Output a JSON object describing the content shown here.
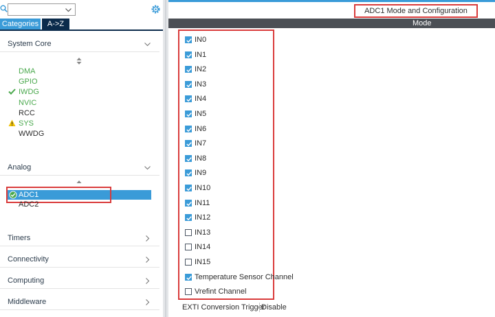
{
  "left": {
    "tabs": [
      {
        "label": "Categories"
      },
      {
        "label": "A->Z"
      }
    ],
    "system_core": {
      "label": "System Core",
      "items": [
        {
          "label": "DMA",
          "status": "none"
        },
        {
          "label": "GPIO",
          "status": "none"
        },
        {
          "label": "IWDG",
          "status": "ok"
        },
        {
          "label": "NVIC",
          "status": "none"
        },
        {
          "label": "RCC",
          "status": "none"
        },
        {
          "label": "SYS",
          "status": "warning"
        },
        {
          "label": "WWDG",
          "status": "none"
        }
      ]
    },
    "analog": {
      "label": "Analog",
      "items": [
        {
          "label": "ADC1",
          "selected": true,
          "status": "ok"
        },
        {
          "label": "ADC2"
        }
      ]
    },
    "categories": [
      {
        "label": "Timers"
      },
      {
        "label": "Connectivity"
      },
      {
        "label": "Computing"
      },
      {
        "label": "Middleware"
      }
    ]
  },
  "right": {
    "title": "ADC1 Mode and Configuration",
    "mode_label": "Mode",
    "channels": [
      {
        "label": "IN0",
        "checked": true
      },
      {
        "label": "IN1",
        "checked": true
      },
      {
        "label": "IN2",
        "checked": true
      },
      {
        "label": "IN3",
        "checked": true
      },
      {
        "label": "IN4",
        "checked": true
      },
      {
        "label": "IN5",
        "checked": true
      },
      {
        "label": "IN6",
        "checked": true
      },
      {
        "label": "IN7",
        "checked": true
      },
      {
        "label": "IN8",
        "checked": true
      },
      {
        "label": "IN9",
        "checked": true
      },
      {
        "label": "IN10",
        "checked": true
      },
      {
        "label": "IN11",
        "checked": true
      },
      {
        "label": "IN12",
        "checked": true
      },
      {
        "label": "IN13",
        "checked": false
      },
      {
        "label": "IN14",
        "checked": false
      },
      {
        "label": "IN15",
        "checked": false
      },
      {
        "label": "Temperature Sensor Channel",
        "checked": true
      },
      {
        "label": "Vrefint Channel",
        "checked": false
      }
    ],
    "exti": {
      "label": "EXTI Conversion Trigger",
      "value": "Disable"
    }
  },
  "colors": {
    "accent": "#3a9bd8",
    "dark_tab": "#0b2b4b",
    "ok_green": "#49a84c",
    "highlight_red": "#d93a3a",
    "warning_yellow": "#f2c200"
  }
}
